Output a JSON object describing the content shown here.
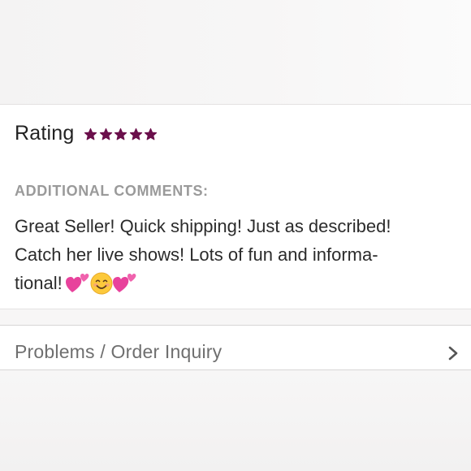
{
  "rating": {
    "label": "Rating",
    "stars_filled": 5,
    "stars_total": 5,
    "star_color": "#6b0f4b",
    "star_icon": "star-icon"
  },
  "comments": {
    "heading": "ADDITIONAL COMMENTS:",
    "lines": [
      "Great Seller! Quick shipping! Just as described!",
      "Catch her live shows! Lots of fun and informa-",
      "tional!"
    ],
    "emojis": [
      "two-hearts-icon",
      "smiling-face-icon",
      "two-hearts-icon"
    ]
  },
  "inquiry": {
    "label": "Problems / Order Inquiry",
    "chevron_icon": "chevron-right-icon"
  },
  "colors": {
    "text_primary": "#222222",
    "text_muted": "#9a9a9a",
    "accent": "#6b0f4b"
  }
}
